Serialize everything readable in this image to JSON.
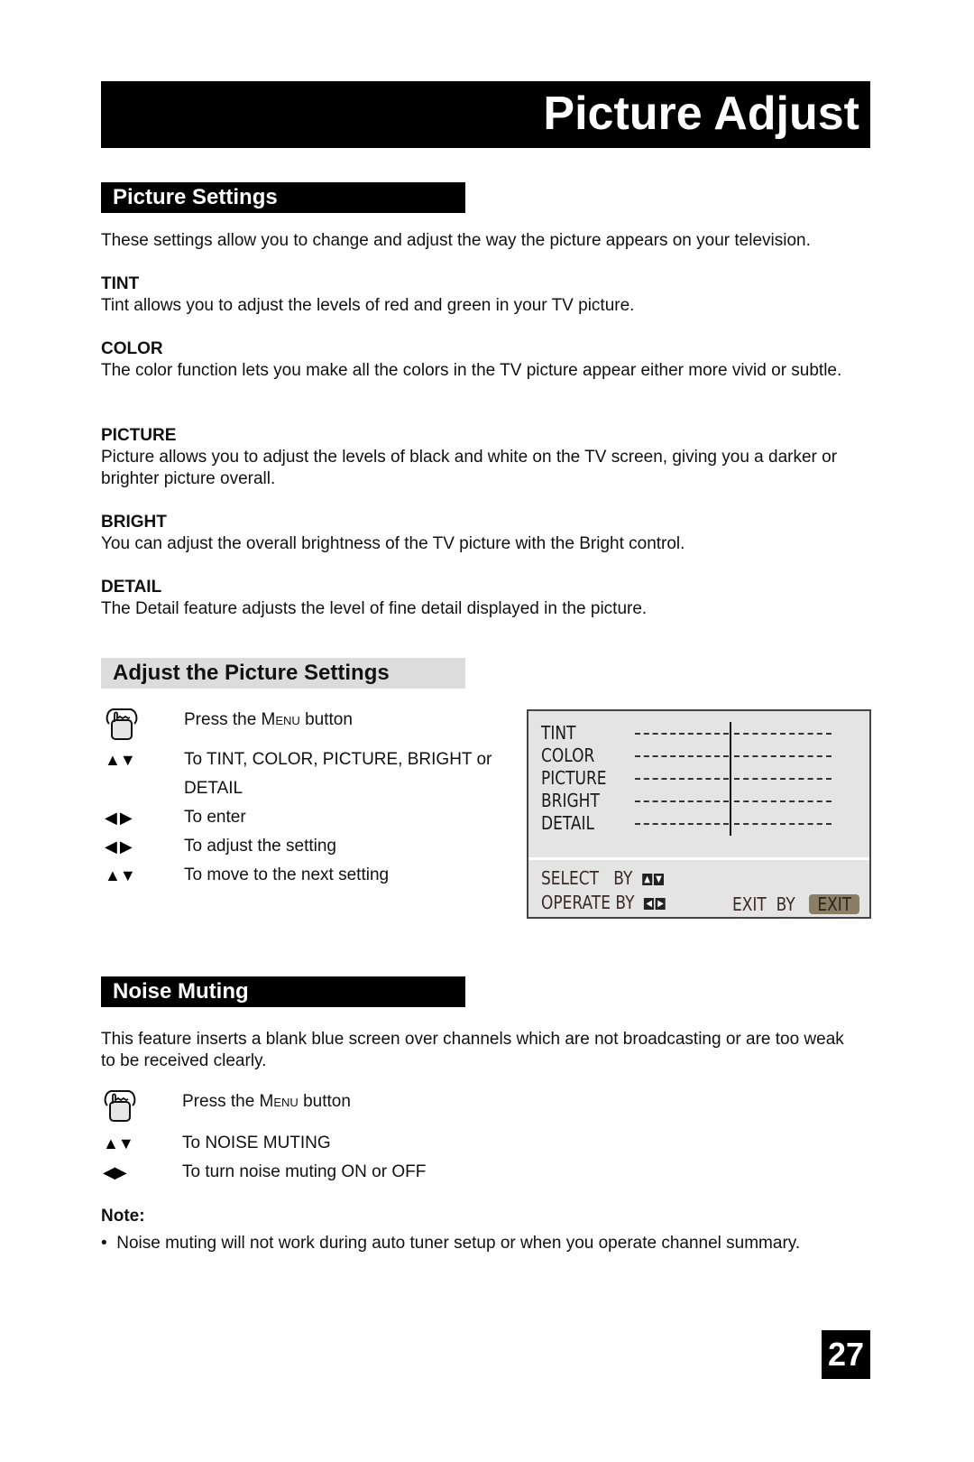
{
  "page_title": "Picture Adjust",
  "picture_settings": {
    "heading": "Picture Settings",
    "intro": "These settings allow you to change and adjust the way the picture appears on your television.",
    "items": [
      {
        "term": "TINT",
        "desc": "Tint allows you to adjust the levels of red and green in your TV picture."
      },
      {
        "term": "COLOR",
        "desc": "The color function lets you make all the colors in the TV picture appear either more vivid or subtle."
      },
      {
        "term": "PICTURE",
        "desc": "Picture allows you to adjust the levels of black and white on the TV screen, giving you a darker or brighter picture overall."
      },
      {
        "term": "BRIGHT",
        "desc": "You can adjust the overall brightness of the TV picture with the Bright control."
      },
      {
        "term": "DETAIL",
        "desc": "The Detail feature adjusts the level of fine detail displayed in the picture."
      }
    ]
  },
  "adjust_settings": {
    "heading": "Adjust the Picture Settings",
    "steps": [
      {
        "icon": "hand-press-icon",
        "pre": "Press the ",
        "key": "Menu",
        "post": " button"
      },
      {
        "icon": "up-down-arrows-icon",
        "glyph": "▲▼",
        "text": "To TINT, COLOR, PICTURE, BRIGHT or DETAIL"
      },
      {
        "icon": "left-right-arrows-icon",
        "glyph": "◀ ▶",
        "text": "To enter"
      },
      {
        "icon": "left-right-arrows-icon",
        "glyph": "◀ ▶",
        "text": "To adjust the setting"
      },
      {
        "icon": "up-down-arrows-icon",
        "glyph": "▲▼",
        "text": "To move to the next setting"
      }
    ],
    "osd": {
      "rows": [
        {
          "label": "TINT",
          "level": 0.5
        },
        {
          "label": "COLOR",
          "level": 0.5
        },
        {
          "label": "PICTURE",
          "level": 0.5
        },
        {
          "label": "BRIGHT",
          "level": 0.5
        },
        {
          "label": "DETAIL",
          "level": 0.5
        }
      ],
      "select_label": "SELECT",
      "operate_label": "OPERATE",
      "by_label": "BY",
      "exit_label": "EXIT",
      "exit_button": "EXIT",
      "exit_button_color": "#8a7e65"
    }
  },
  "noise_muting": {
    "heading": "Noise Muting",
    "intro": "This feature inserts a blank blue screen over channels which are not broadcasting or are too weak to be received clearly.",
    "steps": [
      {
        "icon": "hand-press-icon",
        "pre": "Press the ",
        "key": "Menu",
        "post": " button"
      },
      {
        "icon": "up-down-arrows-icon",
        "glyph": "▲▼",
        "text": "To NOISE MUTING"
      },
      {
        "icon": "left-right-arrows-icon",
        "glyph": "◀▶",
        "text": "To turn noise muting ON or OFF"
      }
    ],
    "note_label": "Note:",
    "notes": [
      "Noise muting will not work during auto tuner setup or when you operate channel summary."
    ]
  },
  "page_number": "27"
}
